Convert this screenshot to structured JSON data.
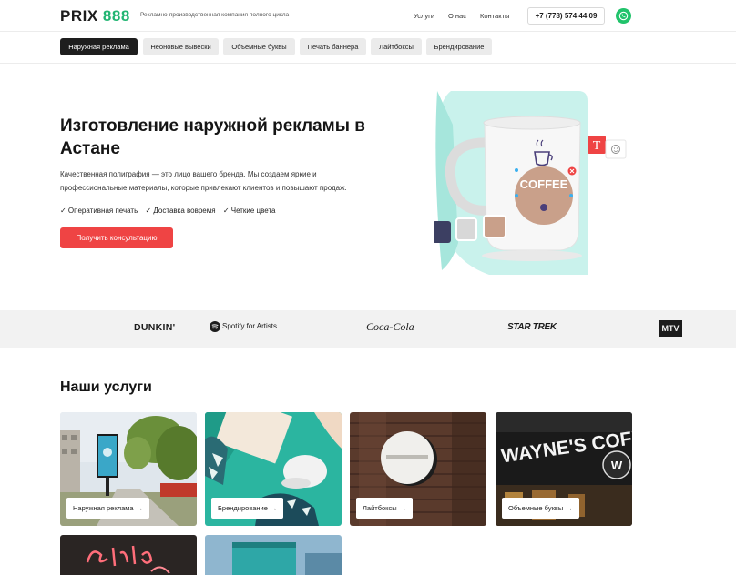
{
  "header": {
    "logo_prefix": "PRIX",
    "logo_number": "888",
    "tagline": "Рекламно-производственная компания полного цикла",
    "nav": [
      "Услуги",
      "О нас",
      "Контакты"
    ],
    "phone": "+7 (778) 574 44 09",
    "whatsapp_icon": "whatsapp-icon"
  },
  "tabs": [
    {
      "label": "Наружная реклама",
      "active": true
    },
    {
      "label": "Неоновые вывески",
      "active": false
    },
    {
      "label": "Объемные буквы",
      "active": false
    },
    {
      "label": "Печать баннера",
      "active": false
    },
    {
      "label": "Лайтбоксы",
      "active": false
    },
    {
      "label": "Брендирование",
      "active": false
    }
  ],
  "hero": {
    "title": "Изготовление наружной рекламы в Астане",
    "description": "Качественная полиграфия — это лицо вашего бренда. Мы создаем яркие и профессиональные материалы, которые привлекают клиентов и повышают продаж.",
    "features": [
      "✓ Оперативная печать",
      "✓ Доставка вовремя",
      "✓ Четкие цвета"
    ],
    "cta": "Получить консультацию",
    "mug_text": "COFFEE",
    "tool_text_icon": "T",
    "colors": {
      "accent": "#ef4444",
      "mint": "#c9f2ec",
      "mug_circle": "#c9a08a"
    }
  },
  "brands": [
    "DUNKIN'",
    "Spotify for Artists",
    "Coca-Cola",
    "STAR TREK",
    "MTV"
  ],
  "services": {
    "title": "Наши услуги",
    "items": [
      {
        "label": "Наружная реклама",
        "arrow": "→"
      },
      {
        "label": "Брендирование",
        "arrow": "→"
      },
      {
        "label": "Лайтбоксы",
        "arrow": "→"
      },
      {
        "label": "Объемные буквы",
        "arrow": "→"
      }
    ],
    "sign_text": "WAYNE'S COFFEE"
  },
  "colors": {
    "brand_green": "#22b573",
    "dark": "#1e1e1e",
    "cta_red": "#ef4444",
    "whatsapp": "#21c36b"
  }
}
